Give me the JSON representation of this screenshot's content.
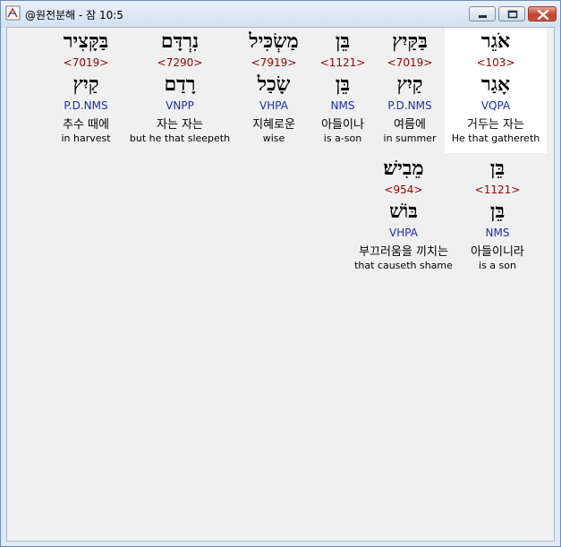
{
  "window": {
    "title": "@원전분해 - 잠 10:5",
    "controls": {
      "minimize_icon": "minimize-icon",
      "maximize_icon": "maximize-icon",
      "close_icon": "close-icon"
    }
  },
  "words": [
    {
      "hebrew": "אֹגֵר",
      "strong": "<103>",
      "lemma": "אָגַר",
      "parse": "VQPA",
      "korean": "거두는 자는",
      "english": "He that gathereth",
      "selected": true
    },
    {
      "hebrew": "בַּקַּיִץ",
      "strong": "<7019>",
      "lemma": "קַיִץ",
      "parse": "P.D.NMS",
      "korean": "여름에",
      "english": "in summer"
    },
    {
      "hebrew": "בֵּן",
      "strong": "<1121>",
      "lemma": "בֵּן",
      "parse": "NMS",
      "korean": "아들이나",
      "english": "is a-son"
    },
    {
      "hebrew": "מַשְׂכִּיל",
      "strong": "<7919>",
      "lemma": "שָׂכַל",
      "parse": "VHPA",
      "korean": "지혜로운",
      "english": "wise"
    },
    {
      "hebrew": "נִרְדָּם",
      "strong": "<7290>",
      "lemma": "רָדַם",
      "parse": "VNPP",
      "korean": "자는 자는",
      "english": "but he that sleepeth"
    },
    {
      "hebrew": "בַּקָּצִיר",
      "strong": "<7019>",
      "lemma": "קַיִץ",
      "parse": "P.D.NMS",
      "korean": "추수 때에",
      "english": "in harvest"
    },
    {
      "hebrew": "בֵּן",
      "strong": "<1121>",
      "lemma": "בֵּן",
      "parse": "NMS",
      "korean": "아들이니라",
      "english": "is a son"
    },
    {
      "hebrew": "מֵבִישׁ׃",
      "strong": "<954>",
      "lemma": "בּוֹשׁ",
      "parse": "VHPA",
      "korean": "부끄러움을 끼치는",
      "english": "that causeth shame"
    }
  ]
}
